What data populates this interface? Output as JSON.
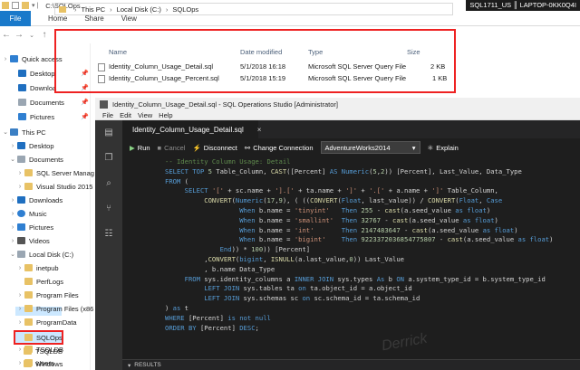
{
  "explorer": {
    "path_title": "C:\\SQLOps",
    "machine_label": "SQL1711_US ║ LAPTOP-0KK0Q4I",
    "tabs": {
      "file": "File",
      "home": "Home",
      "share": "Share",
      "view": "View"
    },
    "breadcrumb": [
      "This PC",
      "Local Disk (C:)",
      "SQLOps"
    ],
    "columns": {
      "name": "Name",
      "date": "Date modified",
      "type": "Type",
      "size": "Size"
    },
    "files": [
      {
        "name": "Identity_Column_Usage_Detail.sql",
        "date": "5/1/2018 16:18",
        "type": "Microsoft SQL Server Query File",
        "size": "2 KB"
      },
      {
        "name": "Identity_Column_Usage_Percent.sql",
        "date": "5/1/2018 15:19",
        "type": "Microsoft SQL Server Query File",
        "size": "1 KB"
      }
    ],
    "nav": {
      "quick_access": "Quick access",
      "desktop": "Desktop",
      "downloads": "Downloa",
      "documents": "Documents",
      "pictures": "Pictures",
      "this_pc": "This PC",
      "pc_desktop": "Desktop",
      "pc_documents": "Documents",
      "sql_server": "SQL Server Manag",
      "visual_studio": "Visual Studio 2015",
      "pc_downloads": "Downloads",
      "music": "Music",
      "pc_pictures": "Pictures",
      "videos": "Videos",
      "local_disk": "Local Disk (C:)",
      "inetpub": "inetpub",
      "perflogs": "PerfLogs",
      "program_files": "Program Files",
      "program_files_x86": "Program Files (x86",
      "program_data": "ProgramData",
      "sqlops": "SQLOps",
      "tsqldb": "TSQLDB",
      "users": "Users",
      "windows": "Windows"
    }
  },
  "ops": {
    "title": "Identity_Column_Usage_Detail.sql - SQL Operations Studio [Administrator]",
    "menu": [
      "File",
      "Edit",
      "View",
      "Help"
    ],
    "tab_label": "Identity_Column_Usage_Detail.sql",
    "toolbar": {
      "run": "Run",
      "cancel": "Cancel",
      "disconnect": "Disconnect",
      "change_connection": "Change Connection",
      "database": "AdventureWorks2014",
      "explain": "Explain"
    },
    "results_label": "RESULTS",
    "watermark": "Derrick"
  }
}
